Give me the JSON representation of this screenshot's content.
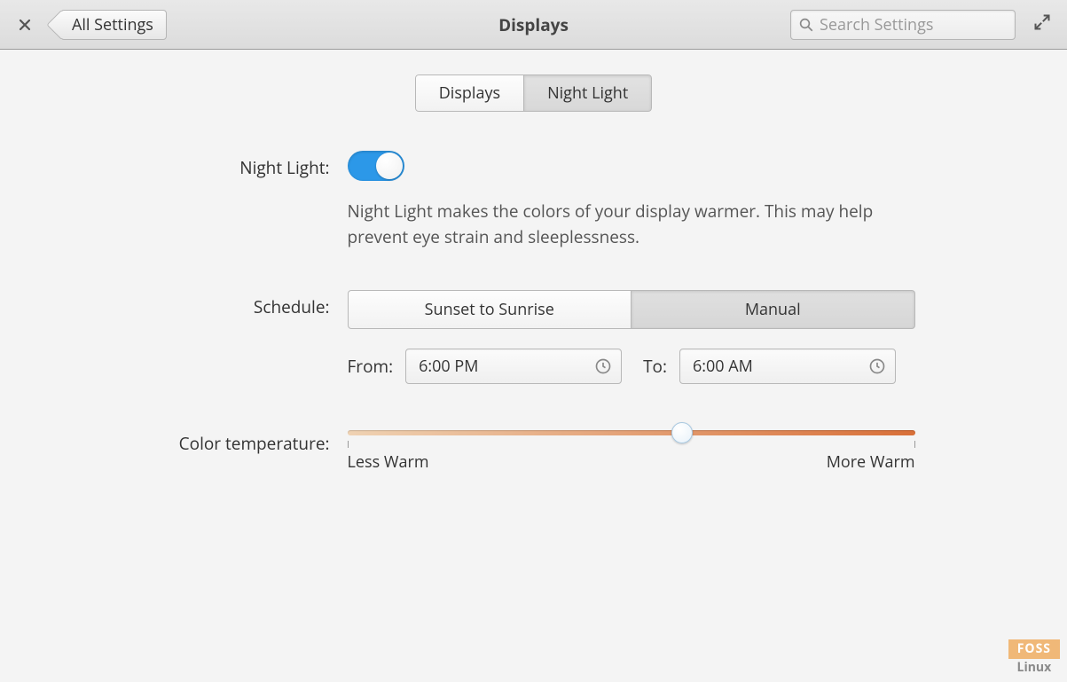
{
  "header": {
    "back_label": "All Settings",
    "title": "Displays",
    "search_placeholder": "Search Settings"
  },
  "tabs": {
    "displays": "Displays",
    "night_light": "Night Light"
  },
  "night_light": {
    "label": "Night Light:",
    "enabled": true,
    "description": "Night Light makes the colors of your display warmer. This may help prevent eye strain and sleeplessness."
  },
  "schedule": {
    "label": "Schedule:",
    "option_auto": "Sunset to Sunrise",
    "option_manual": "Manual",
    "from_label": "From:",
    "from_value": "6:00 PM",
    "to_label": "To:",
    "to_value": "6:00 AM"
  },
  "color_temp": {
    "label": "Color temperature:",
    "min_label": "Less Warm",
    "max_label": "More Warm",
    "value_percent": 59
  },
  "watermark": {
    "top": "FOSS",
    "bottom": "Linux"
  }
}
